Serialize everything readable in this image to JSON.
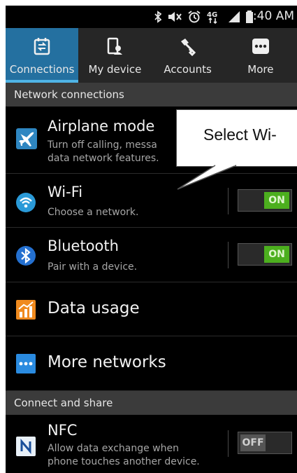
{
  "status": {
    "time": "8:40 AM",
    "icons": [
      "bluetooth-icon",
      "mute-icon",
      "alarm-icon",
      "4g-lte-icon",
      "signal-icon",
      "battery-icon"
    ]
  },
  "tabs": [
    {
      "label": "Connections",
      "icon": "connections-icon",
      "active": true
    },
    {
      "label": "My device",
      "icon": "my-device-icon",
      "active": false
    },
    {
      "label": "Accounts",
      "icon": "accounts-key-icon",
      "active": false
    },
    {
      "label": "More",
      "icon": "more-dots-icon",
      "active": false
    }
  ],
  "sections": {
    "network": "Network connections",
    "share": "Connect and share"
  },
  "rows": {
    "airplane": {
      "title": "Airplane mode",
      "sub1": "Turn off calling, messa",
      "sub2": "data network features."
    },
    "wifi": {
      "title": "Wi-Fi",
      "sub": "Choose a network.",
      "toggle": "ON"
    },
    "bluetooth": {
      "title": "Bluetooth",
      "sub": "Pair with a device.",
      "toggle": "ON"
    },
    "data_usage": {
      "title": "Data usage"
    },
    "more_networks": {
      "title": "More networks"
    },
    "nfc": {
      "title": "NFC",
      "sub1": "Allow data exchange when",
      "sub2": "phone touches another device.",
      "toggle": "OFF"
    }
  },
  "callout": {
    "text": "Select Wi-"
  },
  "colors": {
    "active_tab": "#2470a0",
    "toggle_on": "#4caf1e",
    "section_bg": "#3b3b3b"
  }
}
